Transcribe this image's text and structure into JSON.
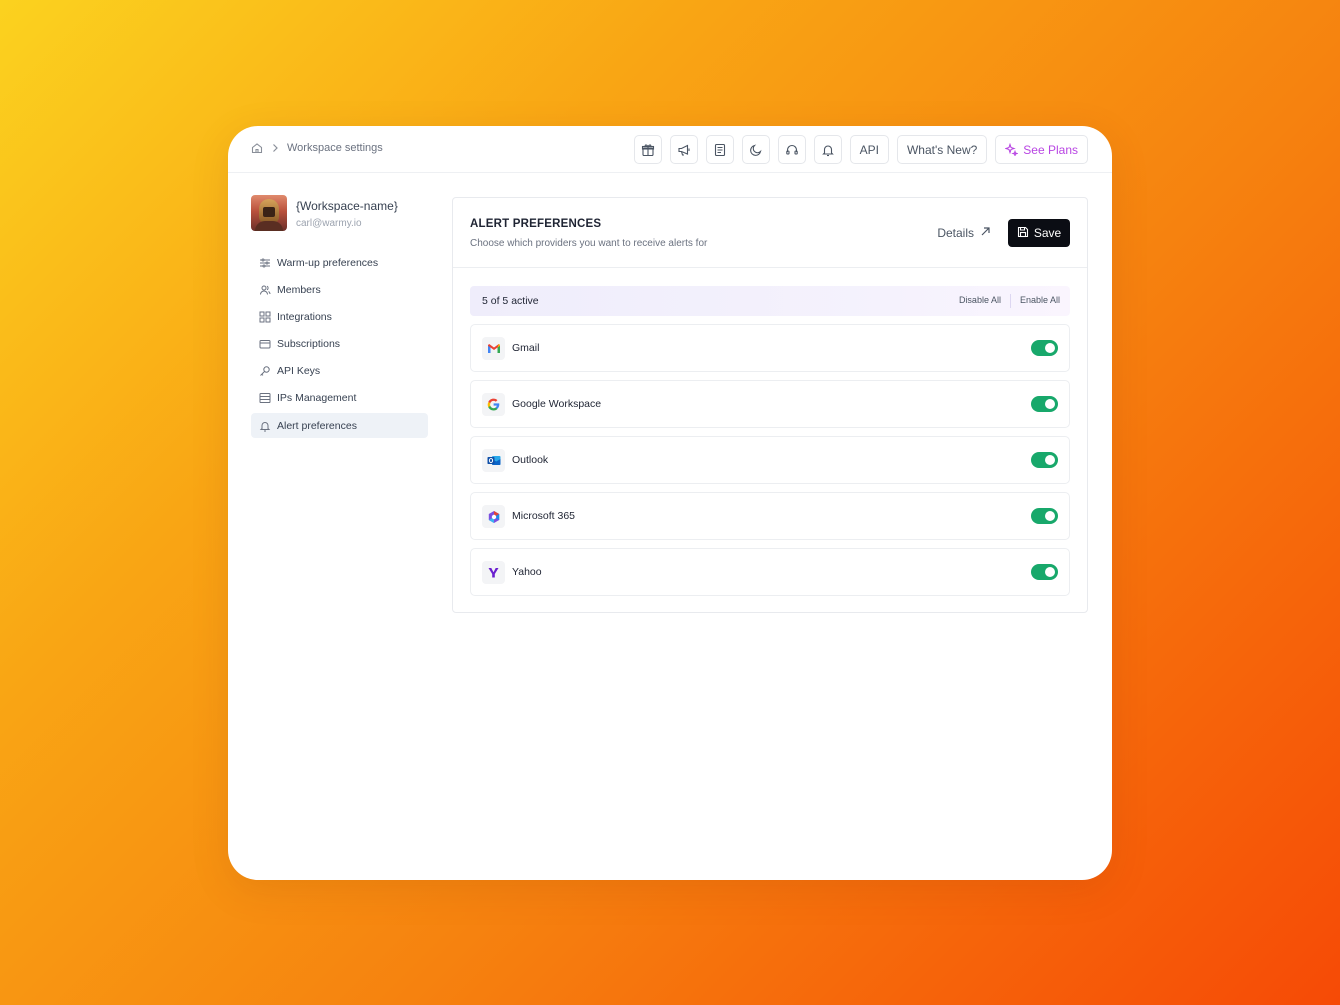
{
  "breadcrumb": {
    "home_icon": "home-icon",
    "current": "Workspace settings"
  },
  "toolbar": {
    "icons": [
      "gift-icon",
      "megaphone-icon",
      "document-icon",
      "moon-icon",
      "headset-icon",
      "bell-icon"
    ],
    "api_label": "API",
    "whats_new_label": "What's New?",
    "see_plans_label": "See Plans",
    "accent": "#b845e3"
  },
  "profile": {
    "workspace_name": "{Workspace-name}",
    "email": "carl@warmy.io"
  },
  "sidebar": {
    "items": [
      {
        "label": "Warm-up preferences",
        "icon": "sliders-icon"
      },
      {
        "label": "Members",
        "icon": "users-icon"
      },
      {
        "label": "Integrations",
        "icon": "grid-icon"
      },
      {
        "label": "Subscriptions",
        "icon": "card-icon"
      },
      {
        "label": "API Keys",
        "icon": "key-icon"
      },
      {
        "label": "IPs Management",
        "icon": "server-icon"
      },
      {
        "label": "Alert preferences",
        "icon": "bell-icon",
        "active": true
      }
    ]
  },
  "panel": {
    "title": "ALERT PREFERENCES",
    "subtitle": "Choose which providers you want to receive alerts for",
    "details_label": "Details",
    "save_label": "Save"
  },
  "summary": {
    "count_text": "5 of 5 active",
    "disable_all": "Disable All",
    "enable_all": "Enable All"
  },
  "providers": [
    {
      "name": "Gmail",
      "icon": "gmail-icon",
      "enabled": true
    },
    {
      "name": "Google Workspace",
      "icon": "google-icon",
      "enabled": true
    },
    {
      "name": "Outlook",
      "icon": "outlook-icon",
      "enabled": true
    },
    {
      "name": "Microsoft 365",
      "icon": "microsoft-365-icon",
      "enabled": true
    },
    {
      "name": "Yahoo",
      "icon": "yahoo-icon",
      "enabled": true
    }
  ],
  "colors": {
    "toggle_on": "#18a86b",
    "save_bg": "#0b0d14"
  }
}
